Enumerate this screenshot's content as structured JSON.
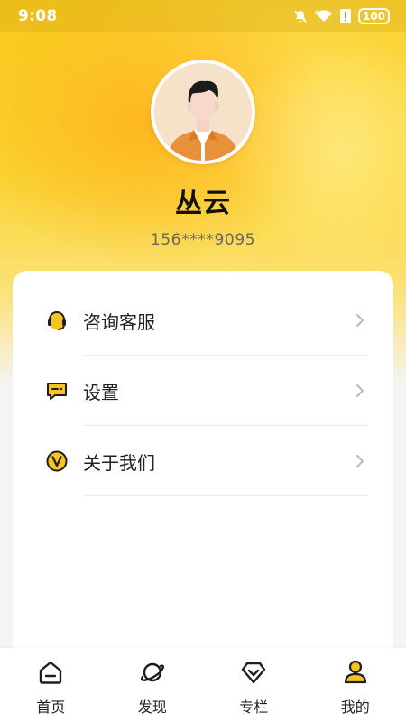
{
  "status_bar": {
    "time": "9:08",
    "battery": "100"
  },
  "profile": {
    "name": "丛云",
    "phone": "156****9095"
  },
  "menu": [
    {
      "label": "咨询客服",
      "icon": "headset-icon"
    },
    {
      "label": "设置",
      "icon": "message-icon"
    },
    {
      "label": "关于我们",
      "icon": "v-badge-icon"
    }
  ],
  "bottom_nav": [
    {
      "label": "首页",
      "icon": "home-icon",
      "active": false
    },
    {
      "label": "发现",
      "icon": "planet-icon",
      "active": false
    },
    {
      "label": "专栏",
      "icon": "diamond-icon",
      "active": false
    },
    {
      "label": "我的",
      "icon": "user-icon",
      "active": true
    }
  ],
  "colors": {
    "accent": "#f7c320",
    "icon_stroke": "#1e1e1e",
    "text": "#222222",
    "subtext": "#666666"
  }
}
